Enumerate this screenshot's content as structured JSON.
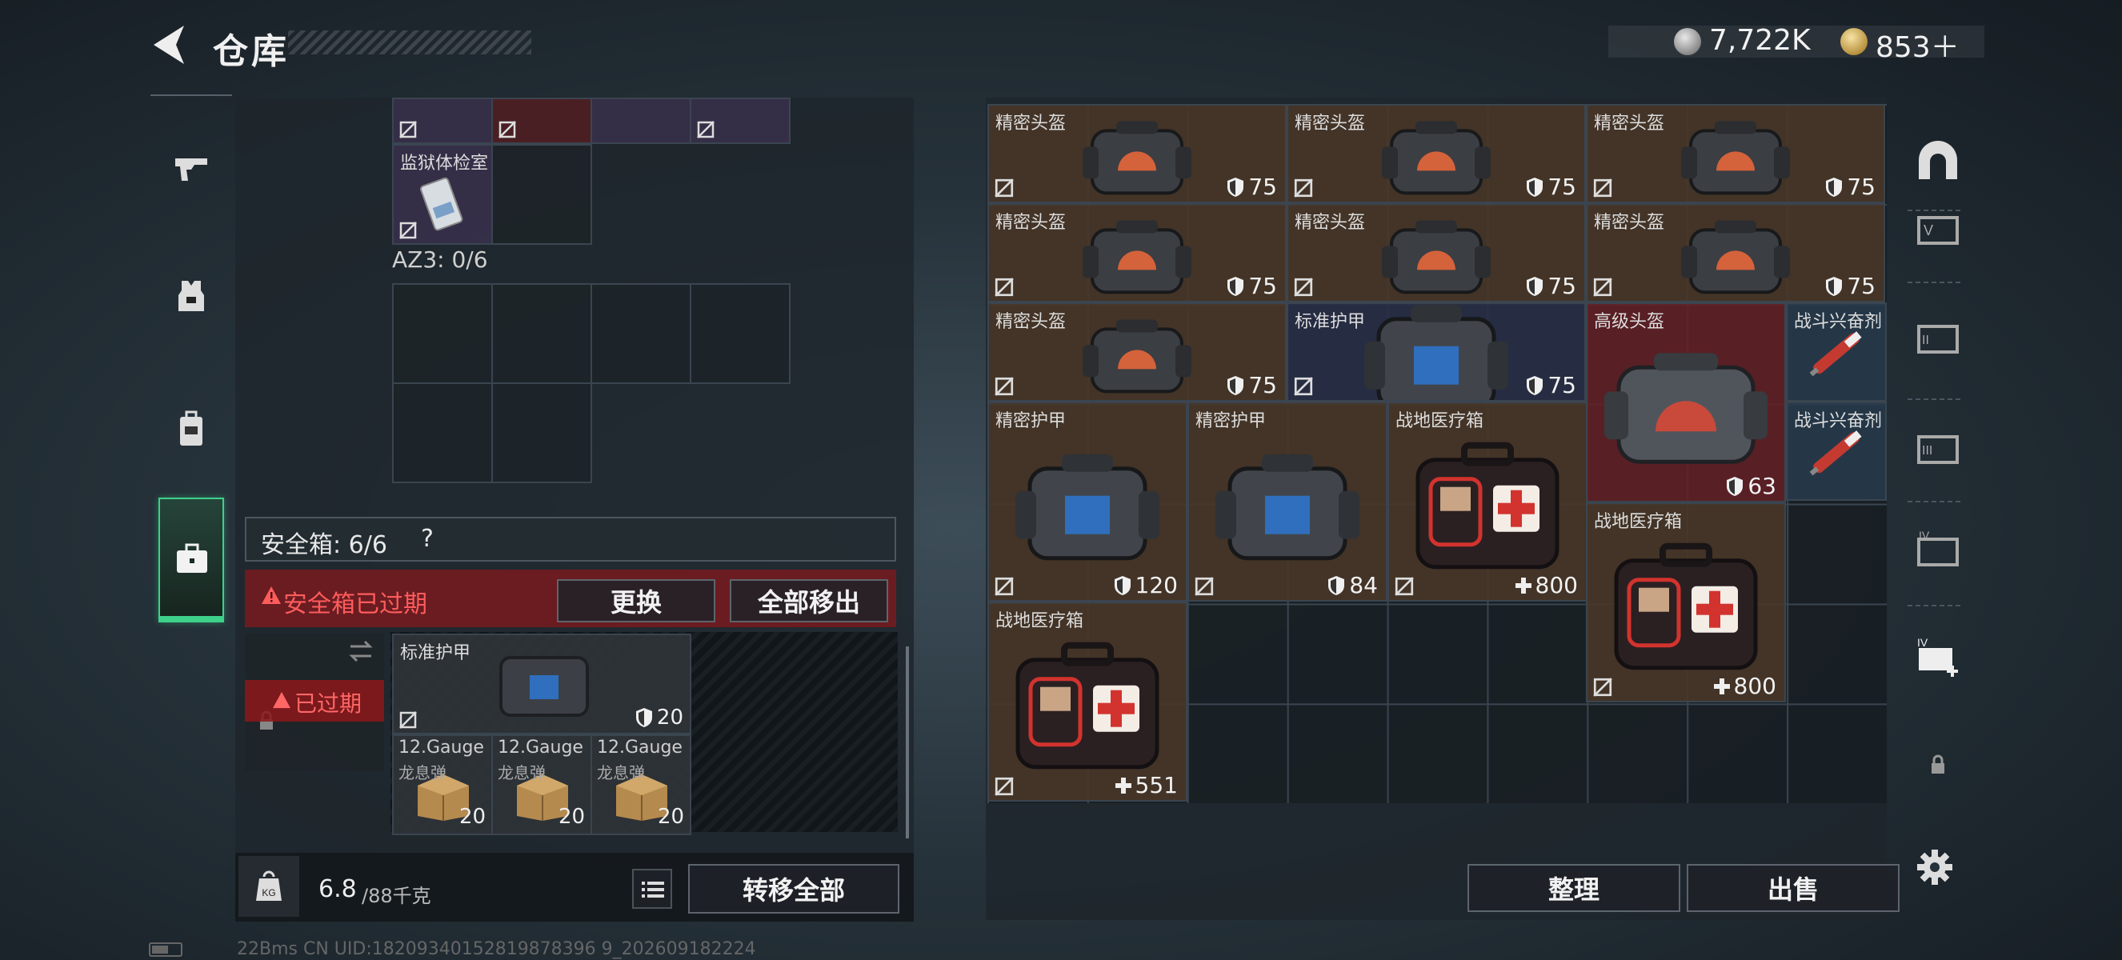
{
  "header": {
    "title": "仓库",
    "silver": "7,722K",
    "gold": "853＋"
  },
  "left": {
    "top_row_items": [
      "",
      "",
      "",
      ""
    ],
    "item_prison": {
      "name": "监狱体检室"
    },
    "az3_label": "AZ3: 0/6",
    "secure_case": {
      "label": "安全箱: 6/6",
      "help": "?",
      "expired_warning": "安全箱已过期",
      "swap_button": "更换",
      "move_all_button": "全部移出",
      "case_badge": "已过期"
    },
    "secure_items": [
      {
        "name": "标准护甲",
        "value": "20"
      },
      {
        "name": "12.Gauge",
        "sub": "龙息弹",
        "count": "20"
      },
      {
        "name": "12.Gauge",
        "sub": "龙息弹",
        "count": "20"
      },
      {
        "name": "12.Gauge",
        "sub": "龙息弹",
        "count": "20"
      }
    ],
    "weight": {
      "current": "6.8",
      "max": "/88千克"
    },
    "transfer_all_button": "转移全部",
    "status": "22Bms CN UID:18209340152819878396 9_202609182224"
  },
  "right": {
    "items": [
      {
        "name": "精密头盔",
        "value": "75"
      },
      {
        "name": "精密头盔",
        "value": "75"
      },
      {
        "name": "精密头盔",
        "value": "75"
      },
      {
        "name": "精密头盔",
        "value": "75"
      },
      {
        "name": "精密头盔",
        "value": "75"
      },
      {
        "name": "精密头盔",
        "value": "75"
      },
      {
        "name": "精密头盔",
        "value": "75"
      },
      {
        "name": "标准护甲",
        "value": "75"
      },
      {
        "name": "高级头盔",
        "value": "63"
      },
      {
        "name": "战斗兴奋剂"
      },
      {
        "name": "战斗兴奋剂"
      },
      {
        "name": "精密护甲",
        "value": "120"
      },
      {
        "name": "精密护甲",
        "value": "84"
      },
      {
        "name": "战地医疗箱",
        "value": "800"
      },
      {
        "name": "战地医疗箱",
        "value": "800"
      },
      {
        "name": "战地医疗箱",
        "value": "551"
      }
    ],
    "sort_button": "整理",
    "sell_button": "出售"
  },
  "colors": {
    "accent_green": "#3fd08a",
    "danger": "#ff5c5c",
    "brown_cell": "#483628",
    "red_cell": "#642024"
  }
}
